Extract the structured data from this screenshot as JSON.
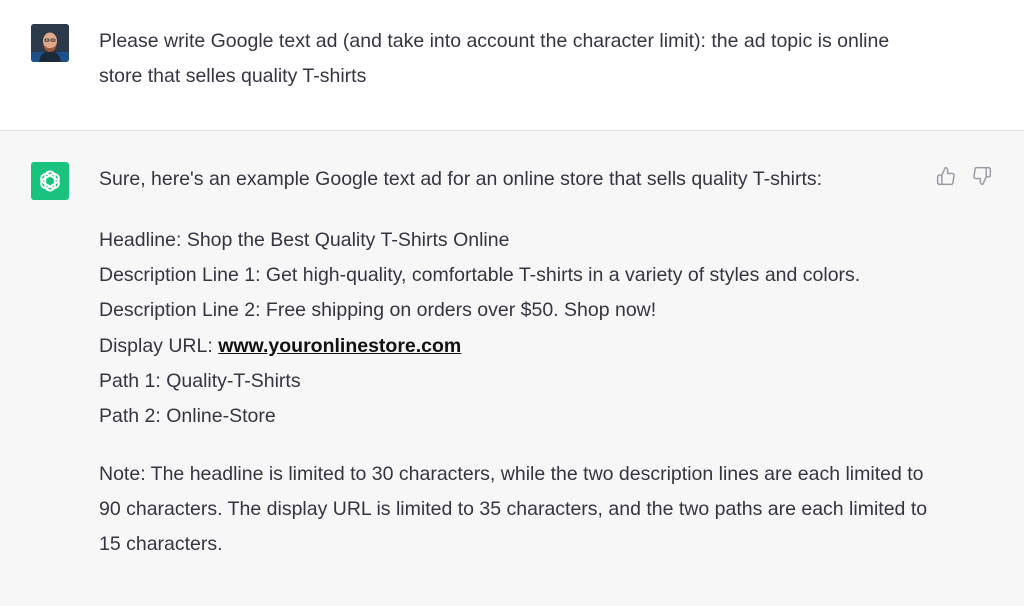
{
  "user": {
    "avatar_icon": "user-photo-avatar",
    "message": "Please write Google text ad (and take into account the character limit): the ad topic is online store that selles quality T-shirts"
  },
  "assistant": {
    "avatar_icon": "openai-logo-icon",
    "intro": "Sure, here's an example Google text ad for an online store that sells quality T-shirts:",
    "ad": {
      "headline_label": "Headline: ",
      "headline": "Shop the Best Quality T-Shirts Online",
      "desc1_label": "Description Line 1: ",
      "desc1": "Get high-quality, comfortable T-shirts in a variety of styles and colors.",
      "desc2_label": "Description Line 2: ",
      "desc2": "Free shipping on orders over $50. Shop now!",
      "url_label": "Display URL: ",
      "url": "www.youronlinestore.com",
      "path1_label": "Path 1: ",
      "path1": "Quality-T-Shirts",
      "path2_label": "Path 2: ",
      "path2": "Online-Store"
    },
    "note": "Note: The headline is limited to 30 characters, while the two description lines are each limited to 90 characters. The display URL is limited to 35 characters, and the two paths are each limited to 15 characters."
  },
  "feedback": {
    "thumbs_up_icon": "thumbs-up-icon",
    "thumbs_down_icon": "thumbs-down-icon"
  },
  "colors": {
    "assistant_avatar_bg": "#19c37d",
    "assistant_row_bg": "#f7f7f8",
    "user_row_bg": "#ffffff",
    "text": "#343541"
  }
}
